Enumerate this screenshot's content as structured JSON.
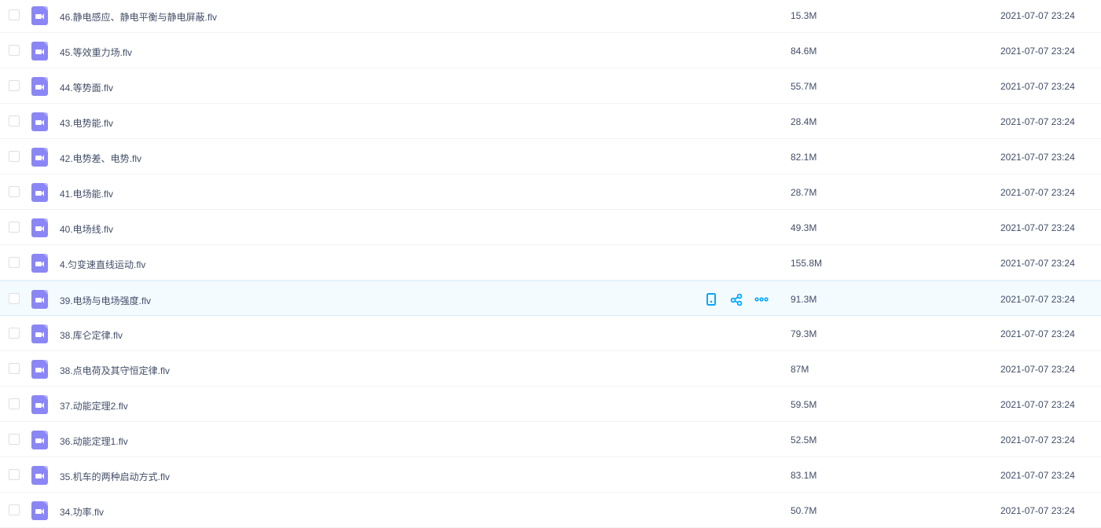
{
  "files": [
    {
      "name": "46.静电感应、静电平衡与静电屏蔽.flv",
      "size": "15.3M",
      "date": "2021-07-07 23:24"
    },
    {
      "name": "45.等效重力场.flv",
      "size": "84.6M",
      "date": "2021-07-07 23:24"
    },
    {
      "name": "44.等势面.flv",
      "size": "55.7M",
      "date": "2021-07-07 23:24"
    },
    {
      "name": "43.电势能.flv",
      "size": "28.4M",
      "date": "2021-07-07 23:24"
    },
    {
      "name": "42.电势差、电势.flv",
      "size": "82.1M",
      "date": "2021-07-07 23:24"
    },
    {
      "name": "41.电场能.flv",
      "size": "28.7M",
      "date": "2021-07-07 23:24"
    },
    {
      "name": "40.电场线.flv",
      "size": "49.3M",
      "date": "2021-07-07 23:24"
    },
    {
      "name": "4.匀变速直线运动.flv",
      "size": "155.8M",
      "date": "2021-07-07 23:24"
    },
    {
      "name": "39.电场与电场强度.flv",
      "size": "91.3M",
      "date": "2021-07-07 23:24",
      "hover": true
    },
    {
      "name": "38.库仑定律.flv",
      "size": "79.3M",
      "date": "2021-07-07 23:24"
    },
    {
      "name": "38.点电荷及其守恒定律.flv",
      "size": "87M",
      "date": "2021-07-07 23:24"
    },
    {
      "name": "37.动能定理2.flv",
      "size": "59.5M",
      "date": "2021-07-07 23:24"
    },
    {
      "name": "36.动能定理1.flv",
      "size": "52.5M",
      "date": "2021-07-07 23:24"
    },
    {
      "name": "35.机车的两种启动方式.flv",
      "size": "83.1M",
      "date": "2021-07-07 23:24"
    },
    {
      "name": "34.功率.flv",
      "size": "50.7M",
      "date": "2021-07-07 23:24"
    }
  ],
  "colors": {
    "accent": "#06a7ff",
    "file_icon": "#8b86f5"
  }
}
